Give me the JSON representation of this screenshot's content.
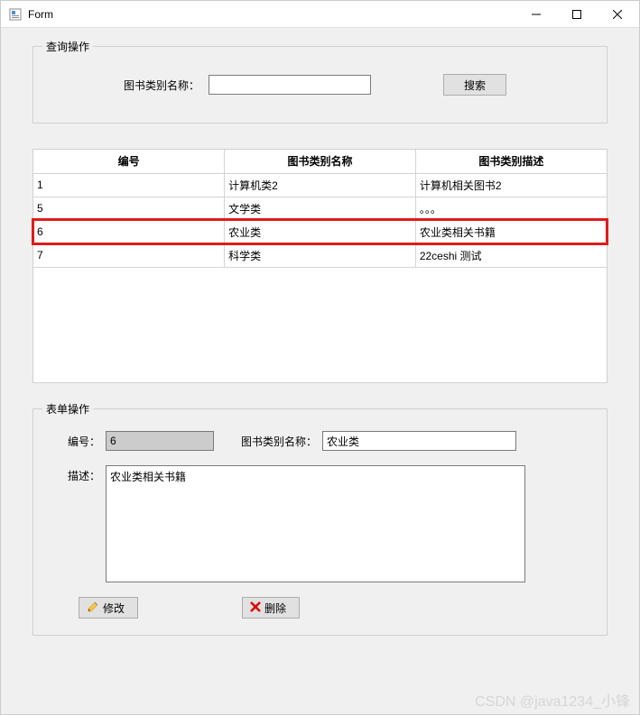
{
  "window": {
    "title": "Form"
  },
  "query_group": {
    "title": "查询操作",
    "label": "图书类别名称：",
    "input_value": "",
    "search_btn": "搜索"
  },
  "table": {
    "columns": [
      "编号",
      "图书类别名称",
      "图书类别描述"
    ],
    "rows": [
      {
        "id": "1",
        "name": "计算机类2",
        "desc": "计算机相关图书2",
        "highlight": false
      },
      {
        "id": "5",
        "name": "文学类",
        "desc": "。。。",
        "highlight": false
      },
      {
        "id": "6",
        "name": "农业类",
        "desc": "农业类相关书籍",
        "highlight": true
      },
      {
        "id": "7",
        "name": "科学类",
        "desc": "22ceshi 测试",
        "highlight": false
      }
    ]
  },
  "form_group": {
    "title": "表单操作",
    "id_label": "编号：",
    "id_value": "6",
    "name_label": "图书类别名称：",
    "name_value": "农业类",
    "desc_label": "描述：",
    "desc_value": "农业类相关书籍",
    "modify_btn": "修改",
    "delete_btn": "删除"
  },
  "watermark": "CSDN @java1234_小锋"
}
